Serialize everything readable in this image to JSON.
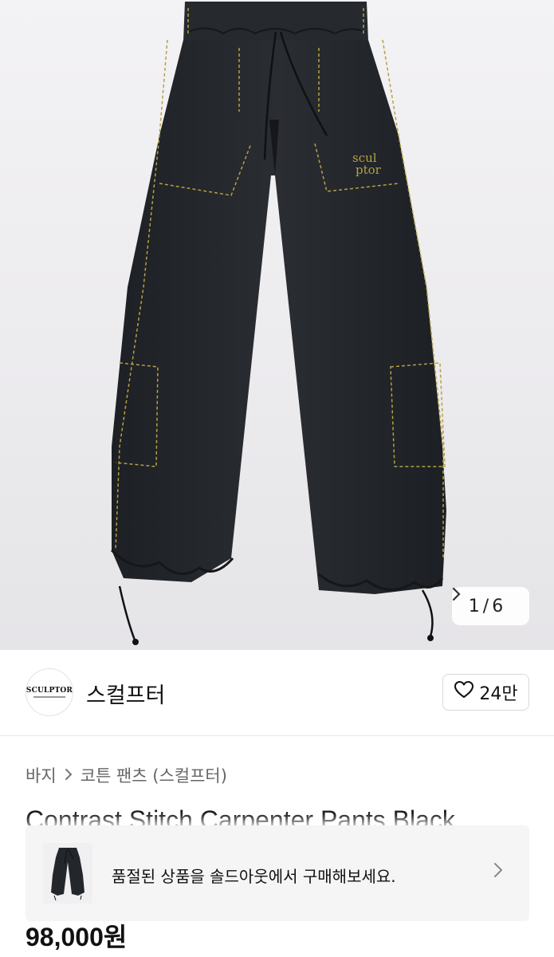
{
  "product_image": {
    "alt": "",
    "logo_print": "scul ptor",
    "pager": {
      "current": "1",
      "separator": "/",
      "total": "6",
      "next_icon": "chevron-right-icon"
    }
  },
  "brand": {
    "logo_text": "SCULPTOR",
    "name": "스컬프터",
    "like_icon": "heart-outline-icon",
    "like_count": "24만"
  },
  "breadcrumb": {
    "items": [
      "바지",
      "코튼 팬츠 (스컬프터)"
    ],
    "separator_icon": "chevron-right-icon"
  },
  "product": {
    "title": "Contrast Stitch Carpenter Pants Black",
    "price": "98,000원"
  },
  "soldout_banner": {
    "message": "품절된 상품을 솔드아웃에서 구매해보세요.",
    "chevron_icon": "chevron-right-icon"
  },
  "colors": {
    "pants": "#23262b",
    "stitch": "#b6a141",
    "text_primary": "#111111",
    "text_secondary": "#666666",
    "border": "#d9d9d9"
  }
}
